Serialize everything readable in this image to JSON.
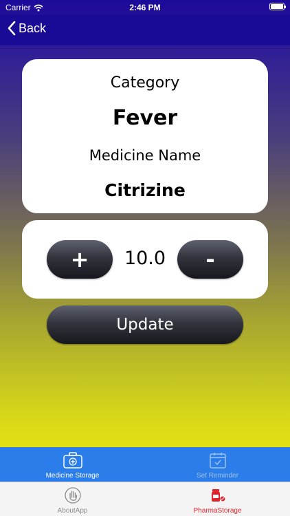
{
  "status_bar": {
    "carrier": "Carrier",
    "time": "2:46 PM"
  },
  "nav": {
    "back_label": "Back"
  },
  "medicine": {
    "category_label": "Category",
    "category_value": "Fever",
    "name_label": "Medicine Name",
    "name_value": "Citrizine"
  },
  "quantity": {
    "plus_label": "+",
    "value": "10.0",
    "minus_label": "-"
  },
  "actions": {
    "update_label": "Update"
  },
  "tabs_top": [
    {
      "label": "Medicine Storage",
      "icon": "medicine-box-icon",
      "color": "#ffffff"
    },
    {
      "label": "Set Reminder",
      "icon": "calendar-check-icon",
      "color": "#9fc3f2"
    }
  ],
  "tabs_bottom": [
    {
      "label": "AboutApp",
      "icon": "hand-icon",
      "color": "#8a8a8a"
    },
    {
      "label": "PharmaStorage",
      "icon": "pills-bottle-icon",
      "color": "#e0242b"
    }
  ],
  "colors": {
    "nav_bar": "#1a0b97",
    "gradient_top": "#1c0a9a",
    "gradient_bottom": "#e2e114",
    "tabbar_top": "#2b7de9",
    "tabbar_bottom": "#f4f4f4",
    "active_bottom_tab": "#e0242b"
  }
}
